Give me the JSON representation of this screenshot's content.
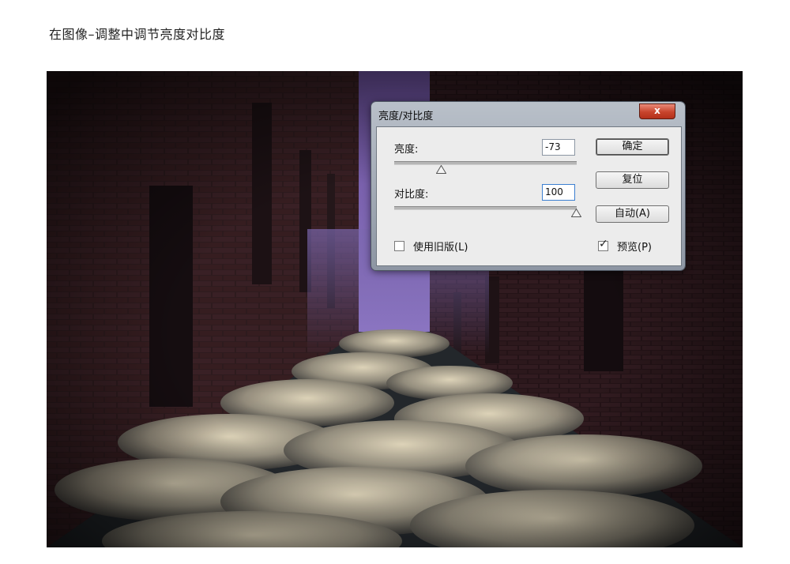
{
  "caption": "在图像–调整中调节亮度对比度",
  "dialog": {
    "title": "亮度/对比度",
    "close_glyph": "x",
    "brightness_label": "亮度:",
    "brightness_value": "-73",
    "contrast_label": "对比度:",
    "contrast_value": "100",
    "legacy_label": "使用旧版(L)",
    "legacy_checked": false,
    "preview_label": "预览(P)",
    "preview_checked": true,
    "ok_label": "确定",
    "reset_label": "复位",
    "auto_label": "自动(A)",
    "check_glyph": "✓"
  },
  "colors": {
    "close_button": "#c8442c",
    "panel_bg": "#ececec",
    "titlebar": "#a9b1bc"
  },
  "icons": [
    "close-icon",
    "slider-thumb-icon",
    "checkbox",
    "checkmark-icon"
  ]
}
